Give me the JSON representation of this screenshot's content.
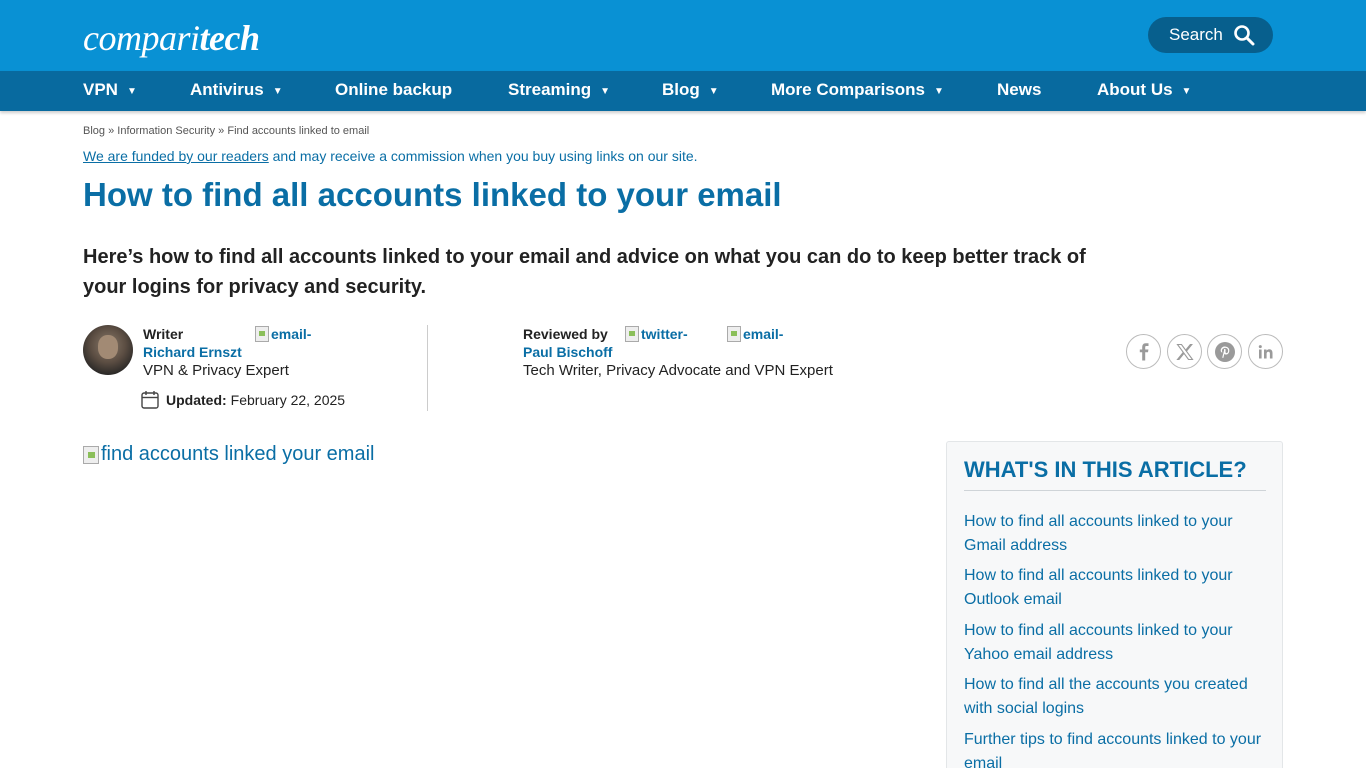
{
  "header": {
    "logo_part1": "compari",
    "logo_part2": "tech",
    "search_label": "Search"
  },
  "nav": [
    {
      "label": "VPN",
      "caret": "▼"
    },
    {
      "label": "Antivirus",
      "caret": "▼"
    },
    {
      "label": "Online backup",
      "caret": ""
    },
    {
      "label": "Streaming",
      "caret": "▼"
    },
    {
      "label": "Blog",
      "caret": "▼"
    },
    {
      "label": "More Comparisons",
      "caret": "▼"
    },
    {
      "label": "News",
      "caret": ""
    },
    {
      "label": "About Us",
      "caret": "▼"
    }
  ],
  "breadcrumb": {
    "blog": "Blog",
    "sep": "»",
    "category": "Information Security",
    "current": "Find accounts linked to email"
  },
  "disclosure": {
    "link": "We are funded by our readers",
    "text": "and may receive a commission when you buy using links on our site."
  },
  "article": {
    "title": "How to find all accounts linked to your email",
    "intro": "Here’s how to find all accounts linked to your email and advice on what you can do to keep better track of your logins for privacy and security."
  },
  "writer": {
    "label": "Writer",
    "name": "Richard Ernszt",
    "role": "VPN & Privacy Expert",
    "email_alt": "email-",
    "updated_label": "Updated:",
    "updated_date": "February 22, 2025"
  },
  "reviewer": {
    "label": "Reviewed by",
    "name": "Paul Bischoff",
    "role": "Tech Writer, Privacy Advocate and VPN Expert",
    "twitter_alt": "twitter-",
    "email_alt": "email-"
  },
  "share": {
    "icons": [
      "facebook-icon",
      "x-icon",
      "pinterest-icon",
      "linkedin-icon"
    ]
  },
  "hero_image_alt": "find accounts linked your email",
  "toc": {
    "title": "WHAT'S IN THIS ARTICLE?",
    "items": [
      "How to find all accounts linked to your Gmail address",
      "How to find all accounts linked to your Outlook email",
      "How to find all accounts linked to your Yahoo email address",
      "How to find all the accounts you created with social logins",
      "Further tips to find accounts linked to your email"
    ]
  },
  "colors": {
    "topbar": "#0991d4",
    "navbar": "#086a9f",
    "link": "#0a6ea5"
  }
}
